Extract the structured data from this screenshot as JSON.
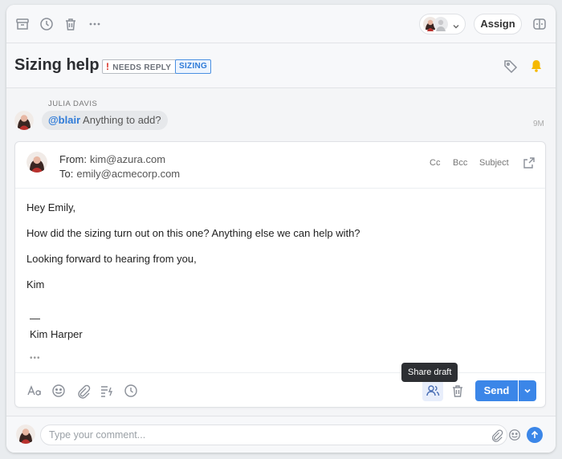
{
  "toolbar": {
    "icons": [
      "archive-icon",
      "clock-icon",
      "trash-icon",
      "more-icon",
      "split-icon"
    ],
    "assign_label": "Assign"
  },
  "conversation": {
    "title": "Sizing help",
    "tags": [
      {
        "label": "NEEDS REPLY",
        "color": "#d93025"
      },
      {
        "label": "SIZING",
        "color": "#2f7bd8"
      }
    ]
  },
  "comment": {
    "author": "JULIA DAVIS",
    "mention": "@blair",
    "text": "Anything to add?",
    "time": "9M"
  },
  "composer": {
    "from_label": "From:",
    "from_value": "kim@azura.com",
    "to_label": "To:",
    "to_value": "emily@acmecorp.com",
    "cc": "Cc",
    "bcc": "Bcc",
    "subject": "Subject",
    "body": [
      "Hey Emily,",
      "How did the sizing turn out on this one? Anything else we can help with?",
      "Looking forward to hearing from you,",
      "Kim"
    ],
    "signature_dash": "—",
    "signature_name": "Kim Harper",
    "ellipsis": "•••",
    "tooltip": "Share draft",
    "send_label": "Send"
  },
  "comment_bar": {
    "placeholder": "Type your comment..."
  },
  "colors": {
    "accent": "#3b86e8",
    "danger": "#d93025",
    "notification": "#f5b800"
  }
}
